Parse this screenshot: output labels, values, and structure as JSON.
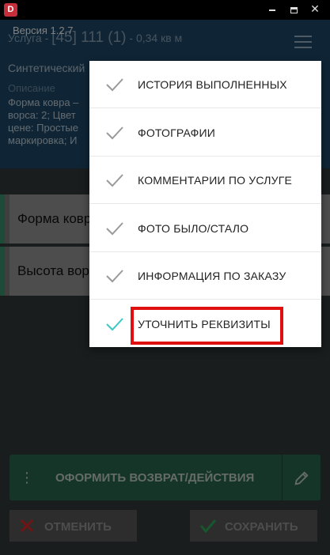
{
  "window": {
    "logo_letter": "D",
    "controls": {
      "close": "✕"
    }
  },
  "header": {
    "version": "Версия 1.2.7",
    "service_label": "Услуга - ",
    "service_code": "[45] 111 (1)",
    "service_area": " - 0,34 кв м",
    "material": "Синтетический",
    "description_label": "Описание",
    "description_lines": [
      "Форма ковра –",
      "ворса: 2; Цвет",
      "цене: Простые",
      "маркировка; И"
    ]
  },
  "fields": [
    {
      "label": "Форма ковр"
    },
    {
      "label": "Высота вор"
    }
  ],
  "menu": {
    "items": [
      {
        "label": "ИСТОРИЯ ВЫПОЛНЕННЫХ"
      },
      {
        "label": "ФОТОГРАФИИ"
      },
      {
        "label": "КОММЕНТАРИИ ПО УСЛУГЕ"
      },
      {
        "label": "ФОТО БЫЛО/СТАЛО"
      },
      {
        "label": "ИНФОРМАЦИЯ ПО ЗАКАЗУ"
      },
      {
        "label": "УТОЧНИТЬ РЕКВИЗИТЫ"
      }
    ],
    "highlighted_index": 5
  },
  "actions": {
    "kebab": "⋮",
    "main_label": "ОФОРМИТЬ ВОЗВРАТ/ДЕЙСТВИЯ",
    "cancel_label": "ОТМЕНИТЬ",
    "save_label": "СОХРАНИТЬ"
  },
  "colors": {
    "header_bg": "#1e4b6d",
    "accent_green": "#3d9470",
    "highlight_red": "#e01010",
    "check_teal": "#3cc8c8"
  }
}
